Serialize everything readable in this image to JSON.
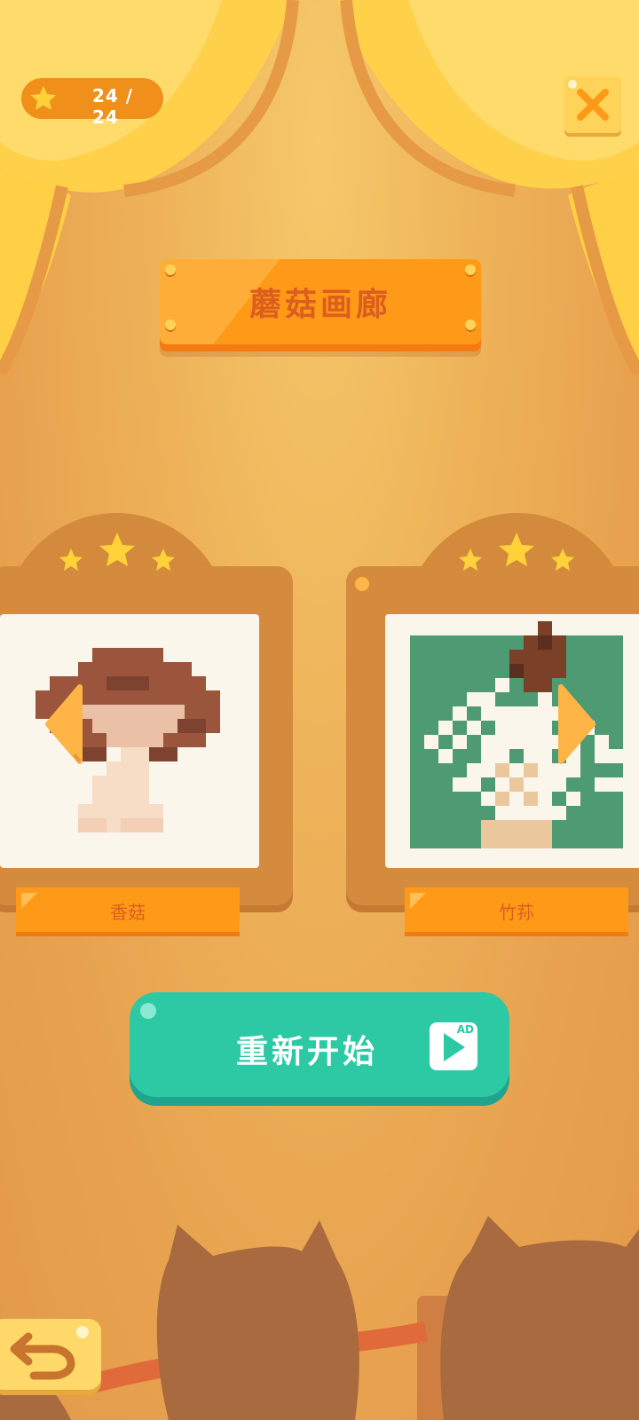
{
  "header": {
    "star_count": "24 / 24",
    "close_icon": "close-x-icon"
  },
  "gallery": {
    "title": "蘑菇画廊",
    "paintings": [
      {
        "name": "香菇",
        "stars": 3,
        "max_stars": 3
      },
      {
        "name": "竹荪",
        "stars": 3,
        "max_stars": 3
      }
    ]
  },
  "restart_button": {
    "label": "重新开始",
    "ad_badge": "AD"
  },
  "colors": {
    "accent_orange": "#ff9a18",
    "title_text": "#dc5e1e",
    "restart_green": "#2dc9a5",
    "frame_brown": "#d58b3d",
    "star_yellow": "#ffd23a"
  }
}
